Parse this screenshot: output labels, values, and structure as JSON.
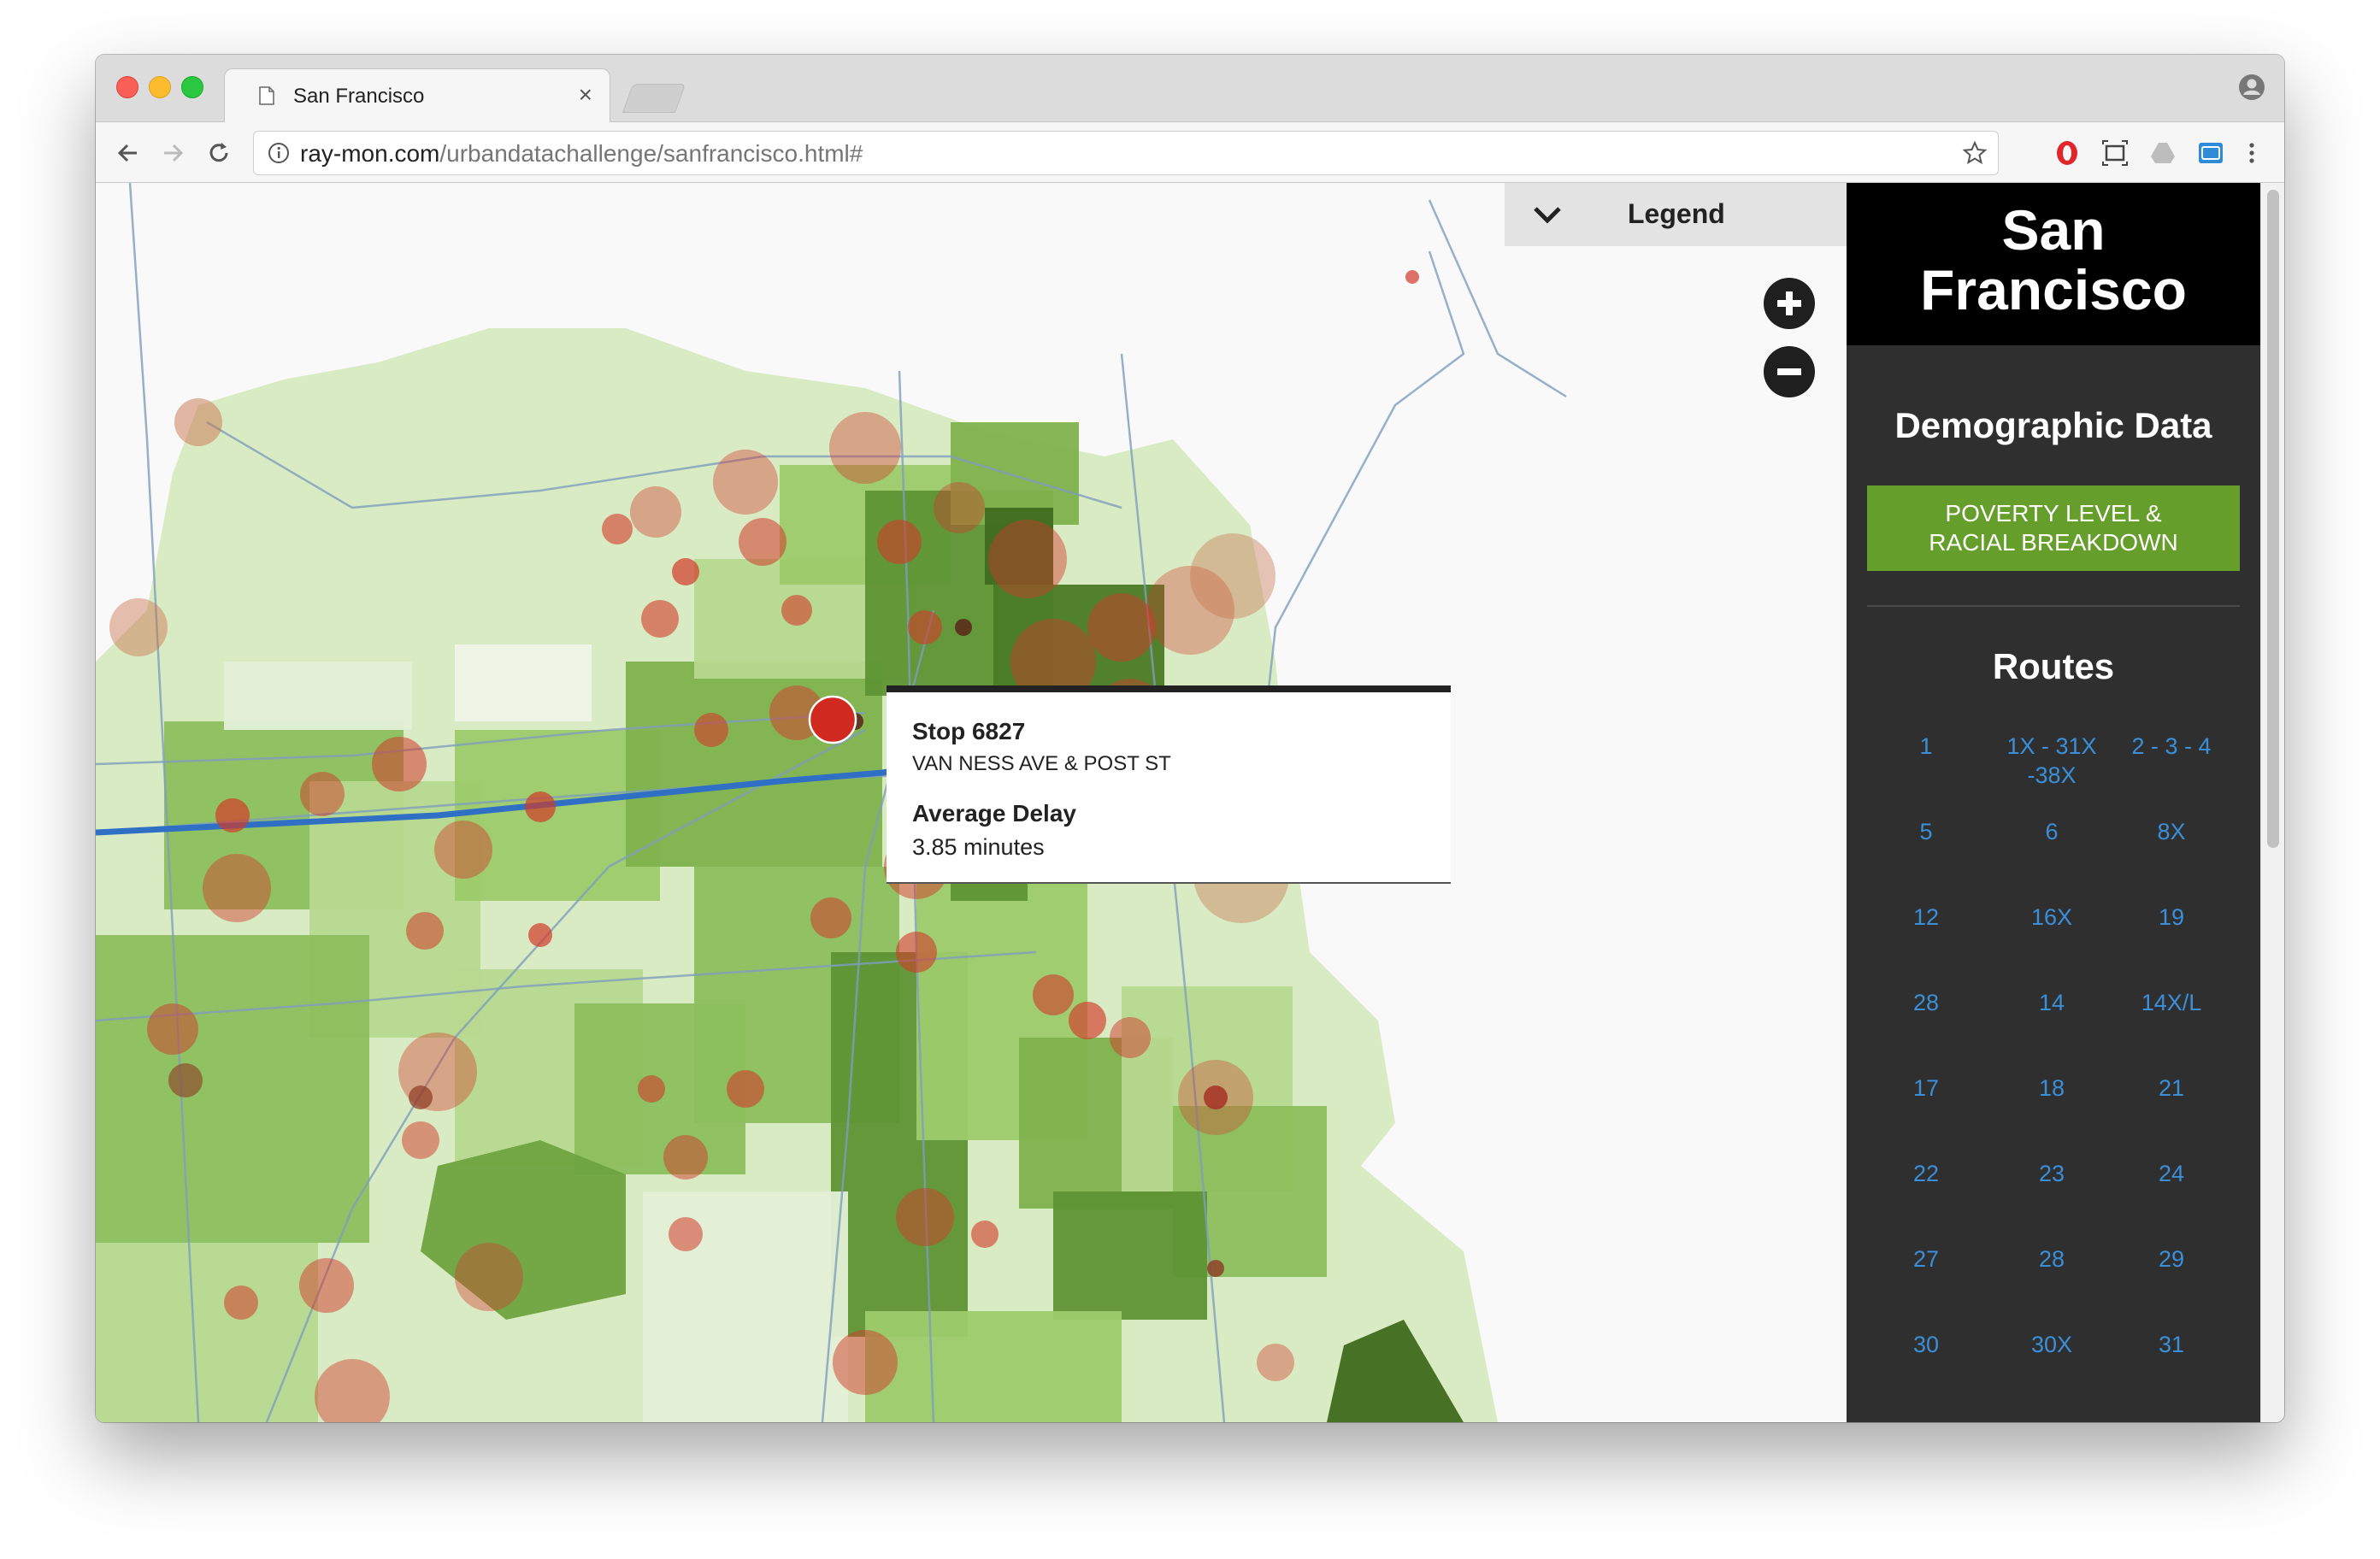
{
  "browser": {
    "tab_title": "San Francisco",
    "tab_close": "×",
    "url_host": "ray-mon.com",
    "url_path": "/urbandatachallenge/sanfrancisco.html#"
  },
  "legend": {
    "title": "Legend"
  },
  "tooltip": {
    "stop": "Stop 6827",
    "address": "VAN NESS AVE & POST ST",
    "label": "Average Delay",
    "value": "3.85 minutes"
  },
  "sidebar": {
    "city_line1": "San",
    "city_line2": "Francisco",
    "demographic_title": "Demographic Data",
    "poverty_line1": "POVERTY LEVEL &",
    "poverty_line2": "RACIAL BREAKDOWN",
    "routes_title": "Routes",
    "routes": [
      [
        "1",
        "1X - 31X -38X",
        "2 - 3 - 4"
      ],
      [
        "5",
        "6",
        "8X"
      ],
      [
        "12",
        "16X",
        "19"
      ],
      [
        "28",
        "14",
        "14X/L"
      ],
      [
        "17",
        "18",
        "21"
      ],
      [
        "22",
        "23",
        "24"
      ],
      [
        "27",
        "28",
        "29"
      ],
      [
        "30",
        "30X",
        "31"
      ]
    ]
  },
  "colors": {
    "route_link": "#3b8fd9",
    "poverty_button": "#669e2b",
    "delay_marker": "#d23a2a",
    "selected_route": "#2f6fc4",
    "map_background": "#f9f9f9"
  },
  "icons": {
    "zoom_in": "plus-circle-icon",
    "zoom_out": "minus-circle-icon",
    "legend_toggle": "chevron-down-icon"
  }
}
